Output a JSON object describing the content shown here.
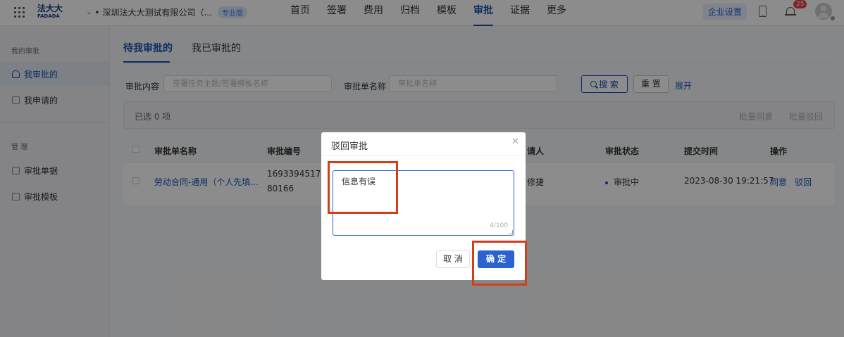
{
  "header": {
    "logo_text": "法大大",
    "logo_sub": "FADADA",
    "company": "深圳法大大测试有限公司（...",
    "edition_badge": "专业版",
    "nav": [
      "首页",
      "签署",
      "费用",
      "归档",
      "模板",
      "审批",
      "证据",
      "更多"
    ],
    "active_nav": "审批",
    "enterprise_settings": "企业设置",
    "notification_count": "25"
  },
  "sidebar": {
    "section_mine": "我的审批",
    "items_mine": [
      "我审批的",
      "我申请的"
    ],
    "section_manage": "管 理",
    "items_manage": [
      "审批单据",
      "审批模板"
    ]
  },
  "main": {
    "tabs": [
      "待我审批的",
      "我已审批的"
    ],
    "filter": {
      "content_label": "审批内容",
      "content_placeholder": "签署任务主题/签署模板名称",
      "form_label": "审批单名称",
      "form_placeholder": "审批单名称",
      "search": "搜 索",
      "reset": "重 置",
      "expand": "展开"
    },
    "selection": {
      "selected": "已选 0 项",
      "batch_approve": "批量同意",
      "batch_reject": "批量驳回"
    },
    "table": {
      "columns": [
        "审批单名称",
        "审批编号",
        "请人",
        "审批状态",
        "提交时间",
        "操作"
      ],
      "rows": [
        {
          "name": "劳动合同-通用（个人先填...",
          "number_line1": "169339451782",
          "number_line2": "80166",
          "applicant": "修捷",
          "status": "审批中",
          "submitted": "2023-08-30 19:21:57",
          "action_approve": "同意",
          "action_reject": "驳回"
        }
      ]
    }
  },
  "modal": {
    "title": "驳回审批",
    "textarea_value": "信息有误",
    "char_count": "4/100",
    "cancel": "取 消",
    "confirm": "确 定"
  },
  "colors": {
    "primary": "#2a62d0",
    "highlight": "#d43d1a",
    "notification": "#e64340"
  }
}
